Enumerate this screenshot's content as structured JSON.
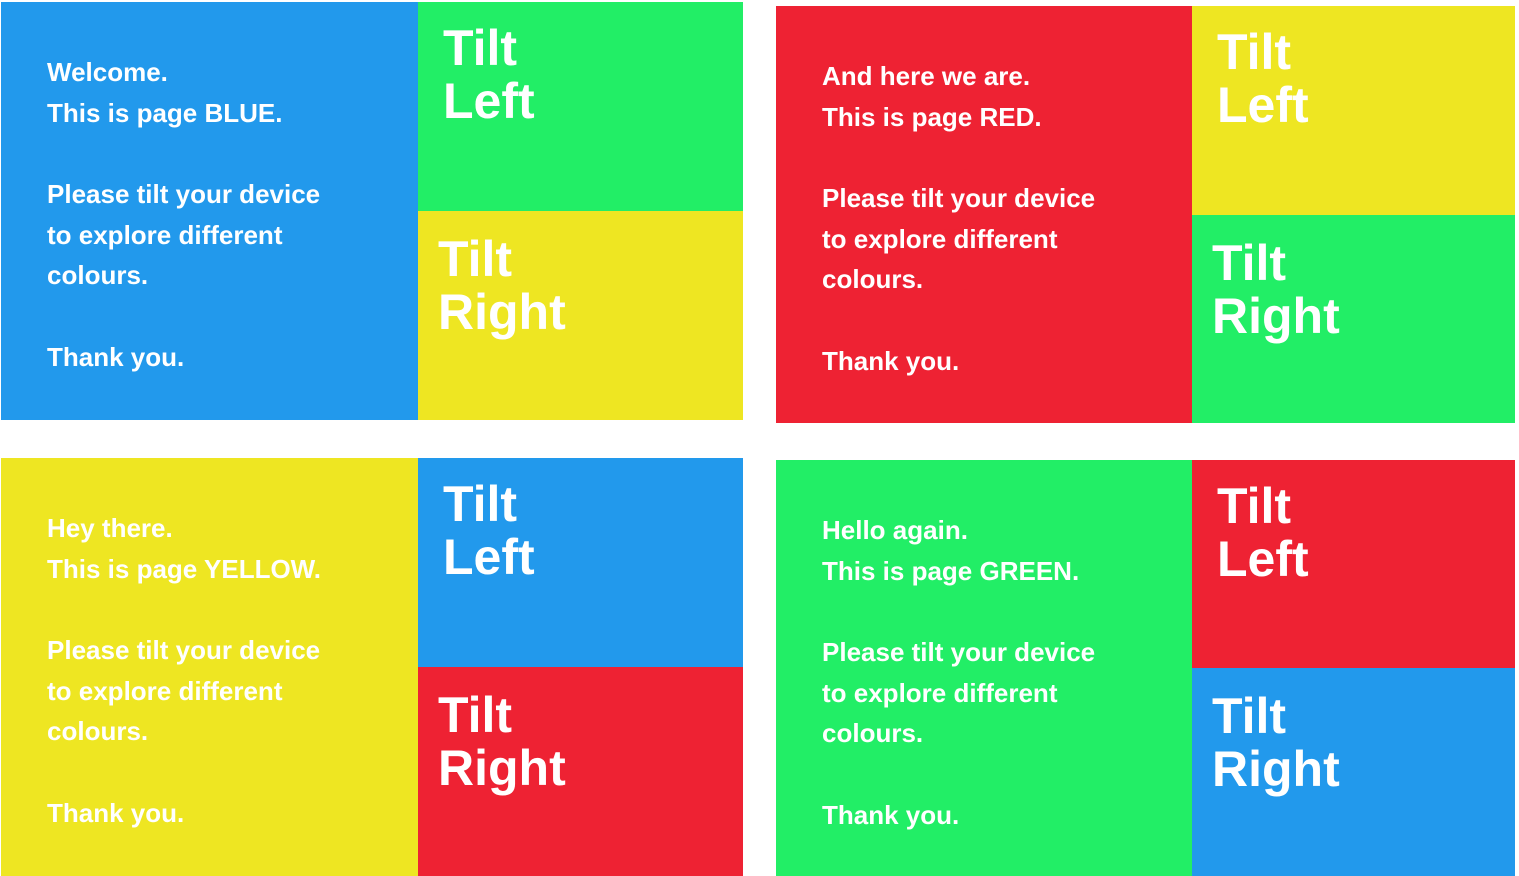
{
  "screens": [
    {
      "id": "blue",
      "colors": {
        "main": "#2299ec",
        "tilt_left": "#22ee66",
        "tilt_right": "#eee622"
      },
      "greeting": "Welcome.",
      "page_line": "This is page BLUE.",
      "instruction_lines": [
        "Please tilt your device",
        "to explore different",
        "colours."
      ],
      "thanks": "Thank you.",
      "tilt_left": {
        "line1": "Tilt",
        "line2": "Left"
      },
      "tilt_right": {
        "line1": "Tilt",
        "line2": "Right"
      }
    },
    {
      "id": "red",
      "colors": {
        "main": "#ee2233",
        "tilt_left": "#eee622",
        "tilt_right": "#22ee66"
      },
      "greeting": "And here we are.",
      "page_line": "This is page RED.",
      "instruction_lines": [
        "Please tilt your device",
        "to explore different",
        "colours."
      ],
      "thanks": "Thank you.",
      "tilt_left": {
        "line1": "Tilt",
        "line2": "Left"
      },
      "tilt_right": {
        "line1": "Tilt",
        "line2": "Right"
      }
    },
    {
      "id": "yellow",
      "colors": {
        "main": "#eee622",
        "tilt_left": "#2299ec",
        "tilt_right": "#ee2233"
      },
      "greeting": "Hey there.",
      "page_line": "This is page YELLOW.",
      "instruction_lines": [
        "Please tilt your device",
        "to explore different",
        "colours."
      ],
      "thanks": "Thank you.",
      "tilt_left": {
        "line1": "Tilt",
        "line2": "Left"
      },
      "tilt_right": {
        "line1": "Tilt",
        "line2": "Right"
      }
    },
    {
      "id": "green",
      "colors": {
        "main": "#22ee66",
        "tilt_left": "#ee2233",
        "tilt_right": "#2299ec"
      },
      "greeting": "Hello again.",
      "page_line": "This is page GREEN.",
      "instruction_lines": [
        "Please tilt your device",
        "to explore different",
        "colours."
      ],
      "thanks": "Thank you.",
      "tilt_left": {
        "line1": "Tilt",
        "line2": "Left"
      },
      "tilt_right": {
        "line1": "Tilt",
        "line2": "Right"
      }
    }
  ]
}
